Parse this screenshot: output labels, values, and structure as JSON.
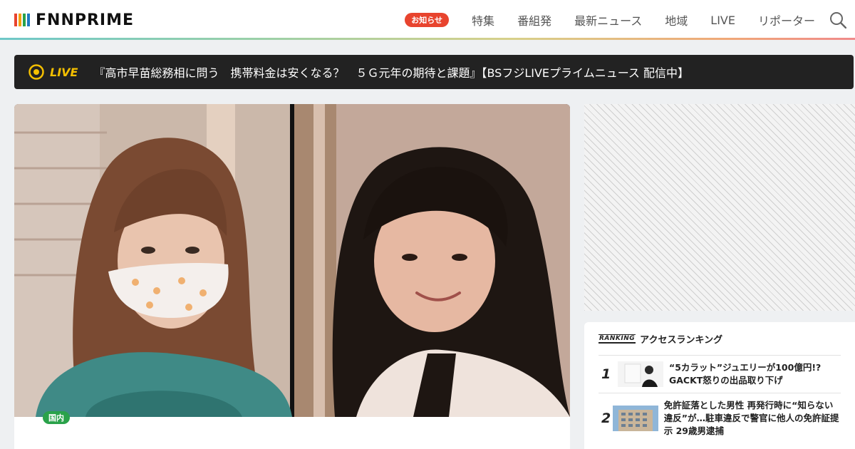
{
  "header": {
    "logo_text": "FNNPRIME",
    "notice_badge": "お知らせ",
    "nav": [
      "特集",
      "番組発",
      "最新ニュース",
      "地域",
      "LIVE",
      "リポーター"
    ]
  },
  "live_bar": {
    "label": "LIVE",
    "text": "『高市早苗総務相に問う　携帯料金は安くなる？　５Ｇ元年の期待と課題』【BSフジLIVEプライムニュース 配信中】"
  },
  "article": {
    "category": "国内",
    "headline_partial": ""
  },
  "ranking": {
    "logo": "RANKING",
    "title": "アクセスランキング",
    "items": [
      {
        "rank": "1",
        "text": "“5カラット”ジュエリーが100億円!? GACKT怒りの出品取り下げ"
      },
      {
        "rank": "2",
        "text": "免許証落とした男性 再発行時に“知らない違反”が…駐車違反で警官に他人の免許証提示 29歳男逮捕"
      }
    ]
  },
  "colors": {
    "live_accent": "#f5c000",
    "notice_red": "#e8442e",
    "category_green": "#2aa24a"
  }
}
